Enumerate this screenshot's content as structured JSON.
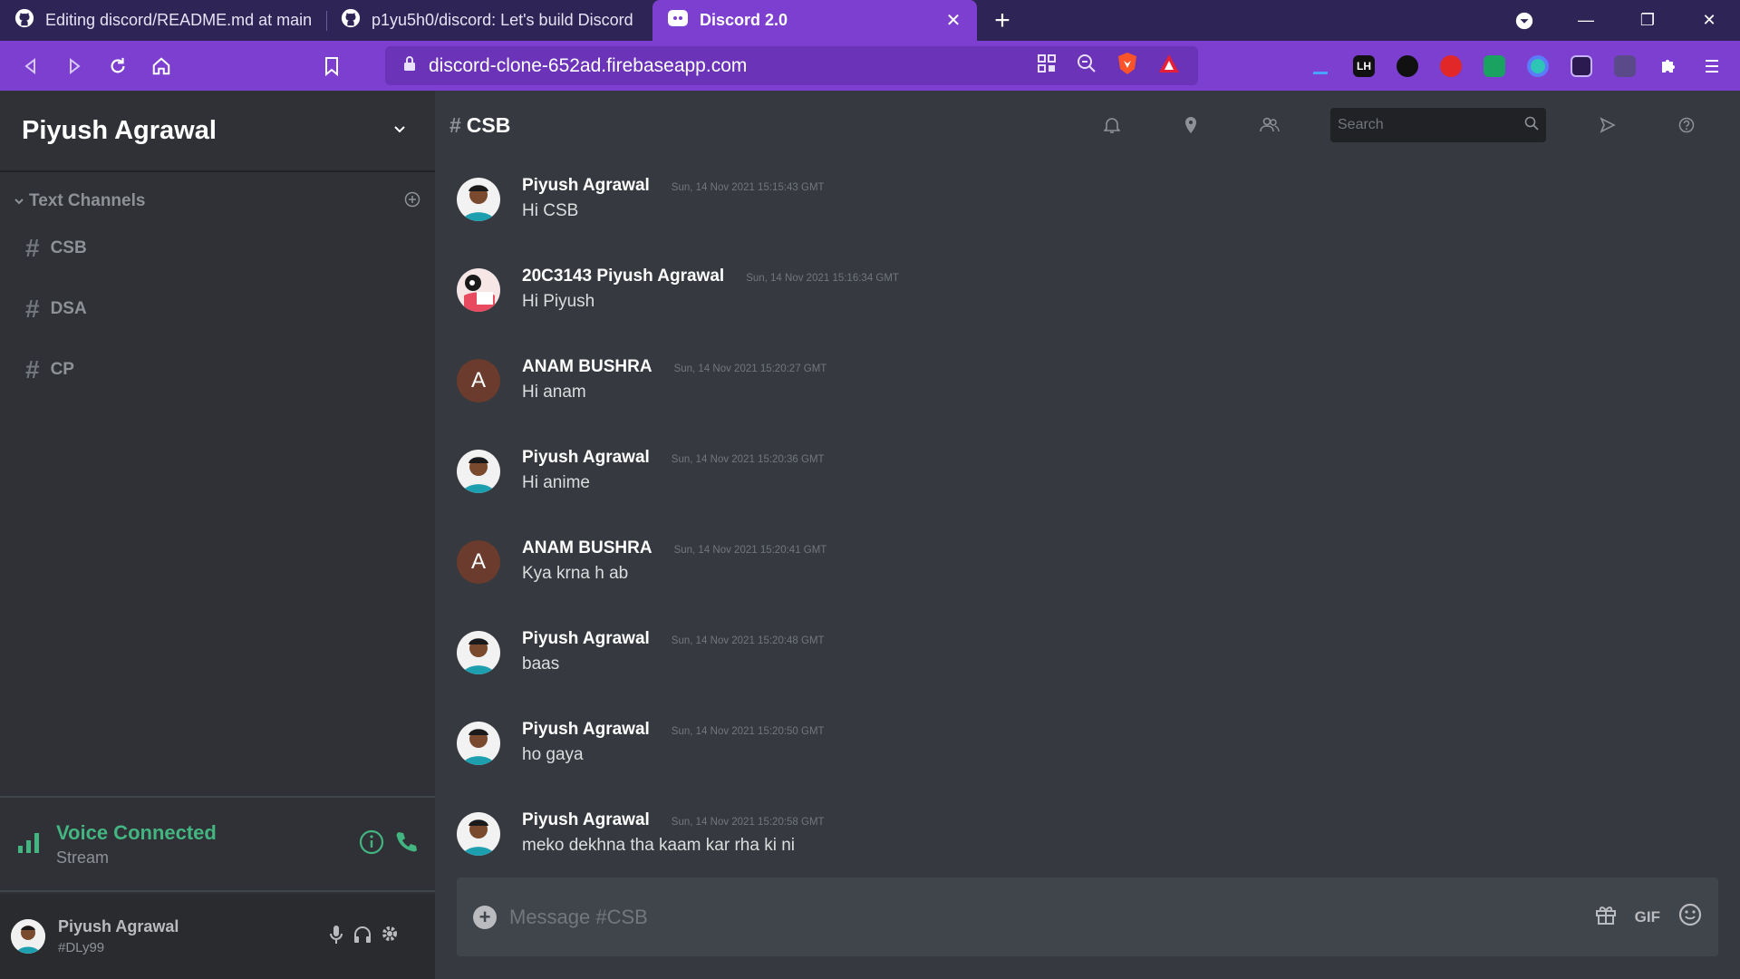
{
  "browser": {
    "tabs": [
      {
        "title": "Editing discord/README.md at main ·",
        "icon": "github-icon",
        "active": false
      },
      {
        "title": "p1yu5h0/discord: Let's build Discord !!",
        "icon": "github-icon",
        "active": false
      },
      {
        "title": "Discord 2.0",
        "icon": "discord-icon",
        "active": true
      }
    ],
    "url": "discord-clone-652ad.firebaseapp.com"
  },
  "sidebar": {
    "server_name": "Piyush Agrawal",
    "channels_label": "Text Channels",
    "channels": [
      {
        "name": "CSB"
      },
      {
        "name": "DSA"
      },
      {
        "name": "CP"
      }
    ],
    "voice": {
      "status": "Voice Connected",
      "sub": "Stream"
    },
    "user": {
      "name": "Piyush Agrawal",
      "tag": "#DLy99"
    }
  },
  "chat": {
    "channel": "CSB",
    "search_placeholder": "Search",
    "composer_placeholder": "Message #CSB",
    "gif_label": "GIF",
    "messages": [
      {
        "author": "Piyush Agrawal",
        "time": "Sun, 14 Nov 2021 15:15:43 GMT",
        "text": "Hi CSB",
        "avatar": "photo"
      },
      {
        "author": "20C3143 Piyush Agrawal",
        "time": "Sun, 14 Nov 2021 15:16:34 GMT",
        "text": "Hi Piyush",
        "avatar": "cartoon"
      },
      {
        "author": "ANAM BUSHRA",
        "time": "Sun, 14 Nov 2021 15:20:27 GMT",
        "text": "Hi anam",
        "avatar": "A"
      },
      {
        "author": "Piyush Agrawal",
        "time": "Sun, 14 Nov 2021 15:20:36 GMT",
        "text": "Hi anime",
        "avatar": "photo"
      },
      {
        "author": "ANAM BUSHRA",
        "time": "Sun, 14 Nov 2021 15:20:41 GMT",
        "text": "Kya krna h ab",
        "avatar": "A"
      },
      {
        "author": "Piyush Agrawal",
        "time": "Sun, 14 Nov 2021 15:20:48 GMT",
        "text": "baas",
        "avatar": "photo"
      },
      {
        "author": "Piyush Agrawal",
        "time": "Sun, 14 Nov 2021 15:20:50 GMT",
        "text": "ho gaya",
        "avatar": "photo"
      },
      {
        "author": "Piyush Agrawal",
        "time": "Sun, 14 Nov 2021 15:20:58 GMT",
        "text": "meko dekhna tha kaam kar rha ki ni",
        "avatar": "photo"
      }
    ]
  },
  "colors": {
    "browser_accent": "#7c3fcf",
    "voice_green": "#43b581",
    "app_bg": "#36393f",
    "sidebar_bg": "#2f3136"
  }
}
